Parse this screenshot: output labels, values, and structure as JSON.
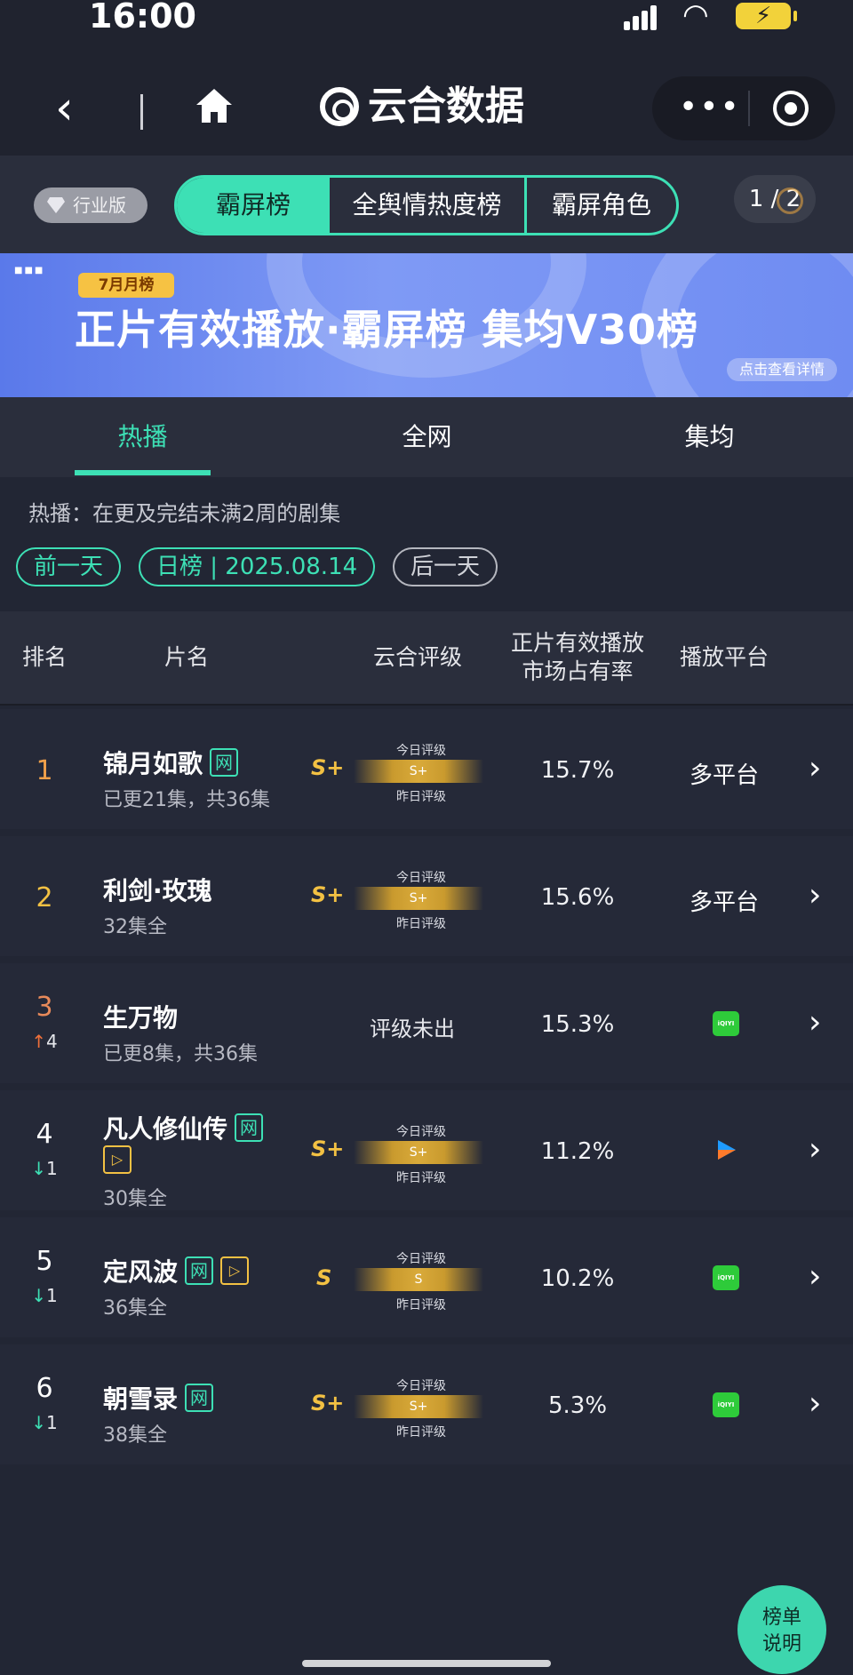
{
  "status": {
    "time": "16:00"
  },
  "nav": {
    "title": "云合数据"
  },
  "top": {
    "badge": "行业版",
    "tabs": [
      "霸屏榜",
      "全舆情热度榜",
      "霸屏角色"
    ],
    "pager": "1 / 2"
  },
  "banner": {
    "tag": "7月月榜",
    "title": "正片有效播放·霸屏榜 集均V30榜",
    "link": "点击查看详情"
  },
  "subtabs": [
    "热播",
    "全网",
    "集均"
  ],
  "filter": {
    "description": "热播：在更及完结未满2周的剧集",
    "prev": "前一天",
    "current": "日榜 | 2025.08.14",
    "next": "后一天"
  },
  "table": {
    "headers": {
      "rank": "排名",
      "title": "片名",
      "grade": "云合评级",
      "share_line1": "正片有效播放",
      "share_line2": "市场占有率",
      "platform": "播放平台"
    },
    "grade_today_label": "今日评级",
    "grade_yesterday_label": "昨日评级",
    "rows": [
      {
        "rank": "1",
        "change": "",
        "title": "锦月如歌",
        "tags": [
          "网"
        ],
        "sub": "已更21集，共36集",
        "grade": "S+",
        "grade_inner": "S+",
        "share": "15.7%",
        "platform": "多平台",
        "rank_color": "#f0a04a"
      },
      {
        "rank": "2",
        "change": "",
        "title": "利剑·玫瑰",
        "tags": [],
        "sub": "32集全",
        "grade": "S+",
        "grade_inner": "S+",
        "share": "15.6%",
        "platform": "多平台",
        "rank_color": "#f3c143"
      },
      {
        "rank": "3",
        "change": "4",
        "change_dir": "up",
        "title": "生万物",
        "tags": [],
        "sub": "已更8集，共36集",
        "grade": "",
        "grade_none": "评级未出",
        "share": "15.3%",
        "platform_icon": "iqiyi-icon",
        "platform_icon_text": "iQIYI",
        "rank_color": "#e88a5a"
      },
      {
        "rank": "4",
        "change": "1",
        "change_dir": "down",
        "title": "凡人修仙传",
        "tags": [
          "网",
          "play"
        ],
        "sub": "30集全",
        "grade": "S+",
        "grade_inner": "S+",
        "share": "11.2%",
        "platform_icon": "youku-icon",
        "rank_color": "#ffffff"
      },
      {
        "rank": "5",
        "change": "1",
        "change_dir": "down",
        "title": "定风波",
        "tags": [
          "网",
          "play"
        ],
        "sub": "36集全",
        "grade": "S",
        "grade_inner": "S",
        "share": "10.2%",
        "platform_icon": "iqiyi-icon",
        "platform_icon_text": "iQIYI",
        "rank_color": "#ffffff"
      },
      {
        "rank": "6",
        "change": "1",
        "change_dir": "down",
        "title": "朝雪录",
        "tags": [
          "网"
        ],
        "sub": "38集全",
        "grade": "S+",
        "grade_inner": "S+",
        "share": "5.3%",
        "platform_icon": "iqiyi-icon",
        "platform_icon_text": "iQIYI",
        "rank_color": "#ffffff"
      }
    ]
  },
  "fab": {
    "line1": "榜单",
    "line2": "说明"
  },
  "icons": {
    "back": "chevron-left-icon",
    "home": "home-icon",
    "more": "more-icon",
    "target": "target-icon",
    "row_chevron": "chevron-right-icon"
  },
  "colors": {
    "accent": "#3de0b5",
    "gold": "#f3c143",
    "bg": "#222634"
  }
}
